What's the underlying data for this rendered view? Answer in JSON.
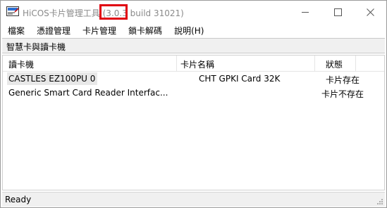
{
  "window": {
    "title_prefix": "HiCOS卡片管理工具 ",
    "title_version": "(3.0.3",
    "title_suffix": " build 31021)",
    "highlight_color": "#e0000f"
  },
  "menu": {
    "items": [
      "檔案",
      "憑證管理",
      "卡片管理",
      "鎖卡解碼",
      "說明(H)"
    ]
  },
  "group": {
    "title": "智慧卡與讀卡機"
  },
  "table": {
    "columns": [
      "讀卡機",
      "卡片名稱",
      "狀態"
    ],
    "rows": [
      {
        "reader": "CASTLES EZ100PU 0",
        "card": "CHT GPKI Card 32K",
        "status": "卡片存在",
        "selected": true
      },
      {
        "reader": "Generic Smart Card Reader Interfac...",
        "card": "",
        "status": "卡片不存在",
        "selected": false
      }
    ]
  },
  "statusbar": {
    "text": "Ready"
  },
  "icons": {
    "app": "card-reader-icon",
    "minimize": "minimize-icon",
    "maximize": "maximize-icon",
    "close": "close-icon",
    "grip": "resize-grip-icon"
  }
}
